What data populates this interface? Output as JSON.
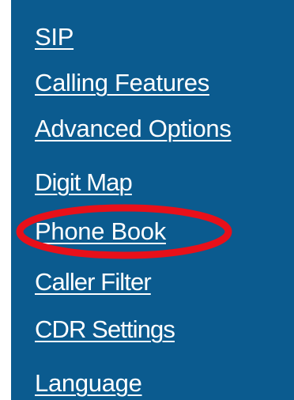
{
  "nav": {
    "items": [
      {
        "label": "SIP"
      },
      {
        "label": "Calling Features"
      },
      {
        "label": "Advanced Options"
      },
      {
        "label": "Digit Map"
      },
      {
        "label": "Phone Book"
      },
      {
        "label": "Caller Filter"
      },
      {
        "label": "CDR Settings"
      },
      {
        "label": "Language"
      }
    ]
  },
  "colors": {
    "panel_background": "#0b5b8f",
    "link_text": "#ffffff",
    "highlight": "#e8101a"
  }
}
